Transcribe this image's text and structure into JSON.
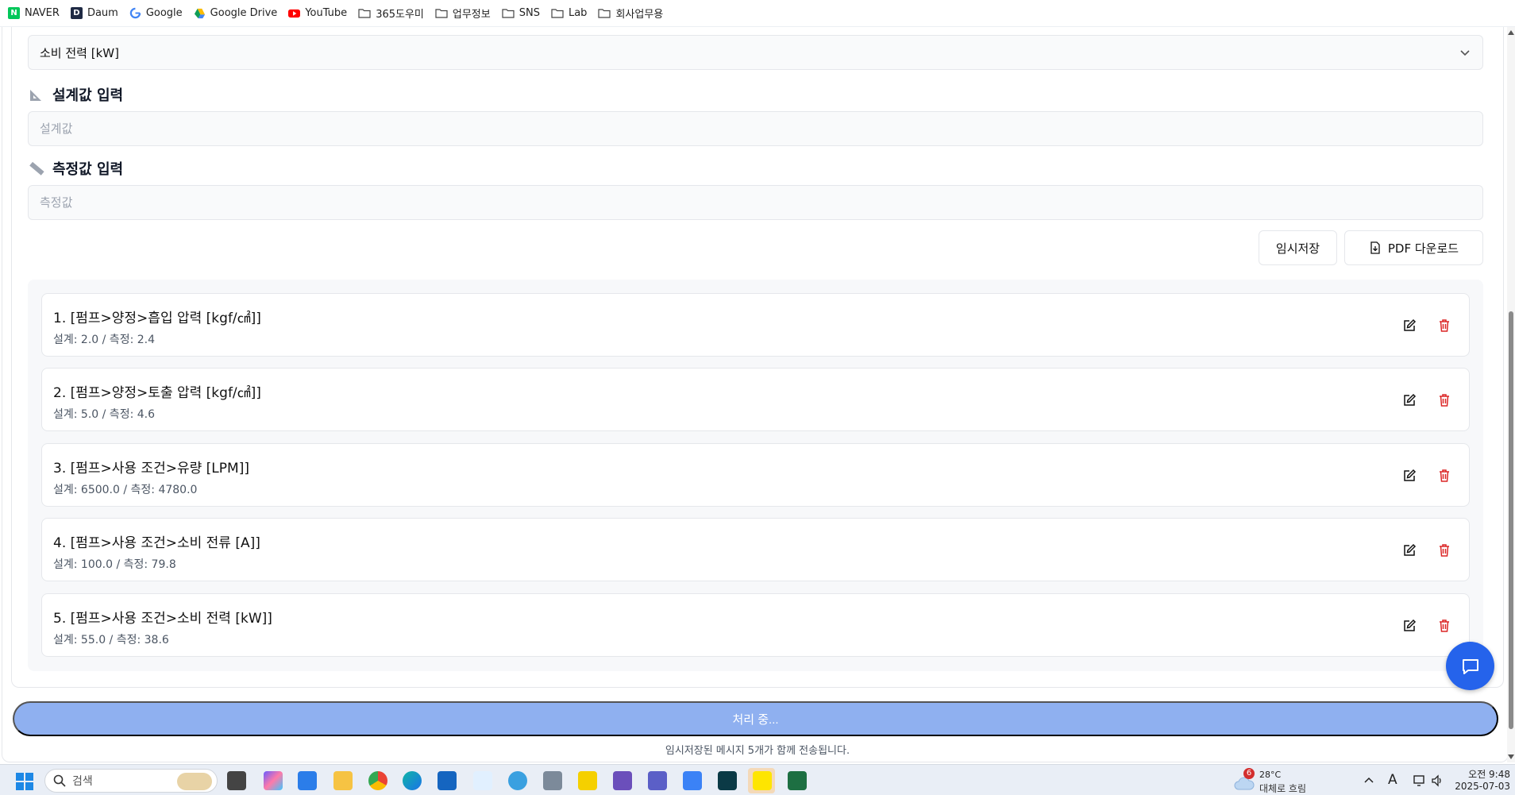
{
  "bookmarks": [
    {
      "label": "NAVER",
      "icon": "naver-icon",
      "color": "#03c75a",
      "letter": "N"
    },
    {
      "label": "Daum",
      "icon": "daum-icon",
      "color": "#1f2a44",
      "letter": "D"
    },
    {
      "label": "Google",
      "icon": "google-icon"
    },
    {
      "label": "Google Drive",
      "icon": "google-drive-icon"
    },
    {
      "label": "YouTube",
      "icon": "youtube-icon"
    },
    {
      "label": "365도우미",
      "icon": "folder-icon"
    },
    {
      "label": "업무정보",
      "icon": "folder-icon"
    },
    {
      "label": "SNS",
      "icon": "folder-icon"
    },
    {
      "label": "Lab",
      "icon": "folder-icon"
    },
    {
      "label": "회사업무용",
      "icon": "folder-icon"
    }
  ],
  "form": {
    "selected_item": "소비 전력 [kW]",
    "design_heading": "설계값 입력",
    "design_placeholder": "설계값",
    "design_value": "",
    "measure_heading": "측정값 입력",
    "measure_placeholder": "측정값",
    "measure_value": ""
  },
  "actions": {
    "temp_save_label": "임시저장",
    "pdf_label": "PDF 다운로드"
  },
  "entries": [
    {
      "title": "1. [펌프>양정>흡입 압력 [kgf/㎠]]",
      "detail": "설계: 2.0 / 측정: 2.4"
    },
    {
      "title": "2. [펌프>양정>토출 압력 [kgf/㎠]]",
      "detail": "설계: 5.0 / 측정: 4.6"
    },
    {
      "title": "3. [펌프>사용 조건>유량 [LPM]]",
      "detail": "설계: 6500.0 / 측정: 4780.0"
    },
    {
      "title": "4. [펌프>사용 조건>소비 전류 [A]]",
      "detail": "설계: 100.0 / 측정: 79.8"
    },
    {
      "title": "5. [펌프>사용 조건>소비 전력 [kW]]",
      "detail": "설계: 55.0 / 측정: 38.6"
    }
  ],
  "submit": {
    "label": "처리 중...",
    "note": "임시저장된 메시지 5개가 함께 전송됩니다."
  },
  "taskbar": {
    "search_placeholder": "검색",
    "weather_temp": "28°C",
    "weather_desc": "대체로 흐림",
    "weather_badge": "6",
    "ime": "A",
    "time": "오전 9:48",
    "date": "2025-07-03"
  },
  "colors": {
    "accent": "#2563eb",
    "submit_disabled": "#8fb0f0",
    "delete": "#dc2626"
  }
}
